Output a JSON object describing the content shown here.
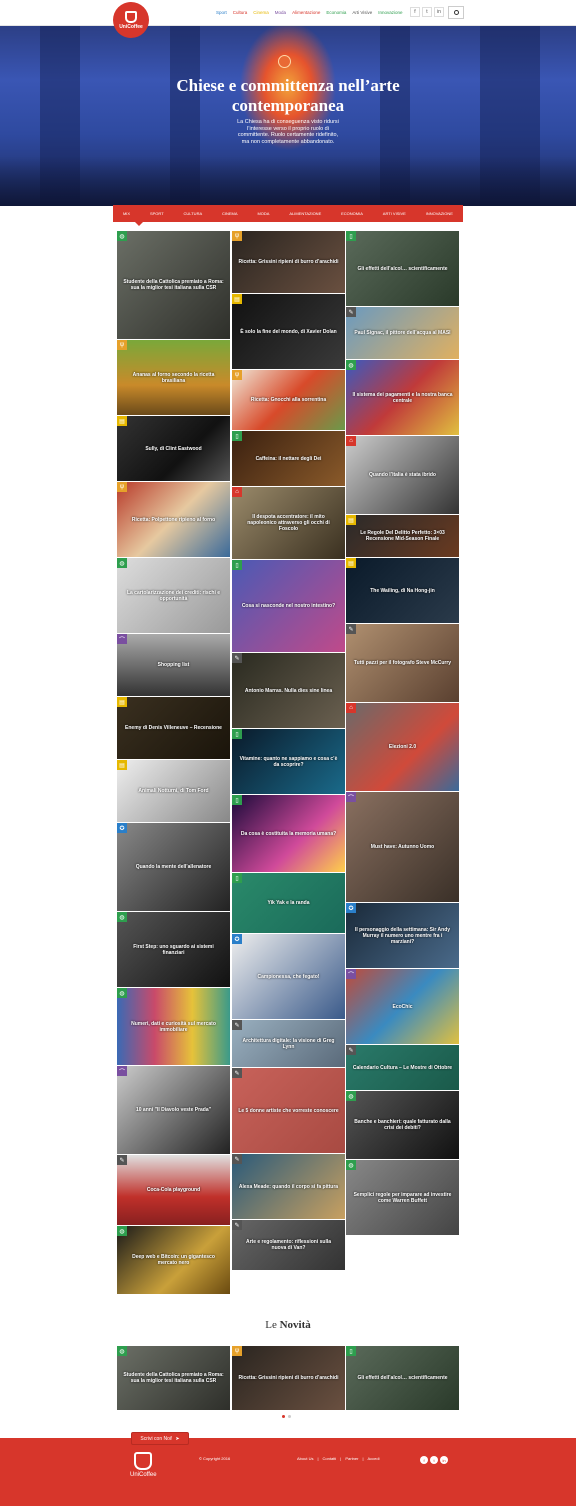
{
  "brand": {
    "name": "UniCoffee",
    "accent": "#d7362b"
  },
  "topnav": [
    {
      "label": "Sport",
      "color": "#2a7fc9"
    },
    {
      "label": "Cultura",
      "color": "#d7362b"
    },
    {
      "label": "Cinema",
      "color": "#e6b800"
    },
    {
      "label": "Moda",
      "color": "#7a4fa0"
    },
    {
      "label": "Alimentazione",
      "color": "#d7362b"
    },
    {
      "label": "Economia",
      "color": "#2e9e4e"
    },
    {
      "label": "Arti Visive",
      "color": "#555555"
    },
    {
      "label": "Innovazione",
      "color": "#2e9e4e"
    }
  ],
  "social": [
    "f",
    "t",
    "in"
  ],
  "hero": {
    "title": "Chiese e committenza nell’arte contemporanea",
    "text": "La Chiesa ha di conseguenza visto ridursi l’interesse verso il proprio ruolo di committente. Ruolo certamente ridefinito, ma non completamente abbandonato."
  },
  "catnav": [
    "MIX",
    "SPORT",
    "CULTURA",
    "CINEMA",
    "MODA",
    "ALIMENTAZIONE",
    "ECONOMIA",
    "ARTI VISIVE",
    "INNOVAZIONE"
  ],
  "tiles": {
    "c1": [
      {
        "cap": "Studente della Cattolica premiato a Roma: sua la miglior tesi italiana sulla CSR",
        "icon": "globe-icon",
        "badge": "#2e9e4e",
        "bg": "linear-gradient(135deg,#6b6f66,#2e2f2a)",
        "h": 108
      },
      {
        "cap": "Ananas al forno secondo la ricetta brasiliana",
        "icon": "fork-icon",
        "badge": "#e6a12a",
        "bg": "linear-gradient(180deg,#7aa83a,#c98a2a 60%,#6a4a1a)",
        "h": 75
      },
      {
        "cap": "Sully, di Clint Eastwood",
        "icon": "film-icon",
        "badge": "#e6b800",
        "bg": "linear-gradient(135deg,#333,#111 60%,#555)",
        "h": 65
      },
      {
        "cap": "Ricetta: Polpettone ripieno al forno",
        "icon": "fork-icon",
        "badge": "#e6a12a",
        "bg": "linear-gradient(135deg,#b83a2a,#e6c9a0 50%,#3a6a9a)",
        "h": 75
      },
      {
        "cap": "La cartolarizzazione dei crediti: rischi e opportunità",
        "icon": "globe-icon",
        "badge": "#2e9e4e",
        "bg": "linear-gradient(135deg,#ddd,#999)",
        "h": 75
      },
      {
        "cap": "Shopping list",
        "icon": "hanger-icon",
        "badge": "#7a4fa0",
        "bg": "linear-gradient(180deg,#aaa,#333)",
        "h": 62
      },
      {
        "cap": "Enemy di Denis Villeneuve – Recensione",
        "icon": "film-icon",
        "badge": "#e6b800",
        "bg": "linear-gradient(135deg,#3a3020,#1a140a)",
        "h": 62
      },
      {
        "cap": "Animali Notturni, di Tom Ford",
        "icon": "film-icon",
        "badge": "#e6b800",
        "bg": "linear-gradient(135deg,#eee,#888)",
        "h": 62
      },
      {
        "cap": "Quando la mente dell’allenatore",
        "icon": "medal-icon",
        "badge": "#2a7fc9",
        "bg": "linear-gradient(135deg,#888,#222)",
        "h": 88
      },
      {
        "cap": "First Step: uno sguardo ai sistemi finanziari",
        "icon": "globe-icon",
        "badge": "#2e9e4e",
        "bg": "linear-gradient(135deg,#555,#111)",
        "h": 75
      },
      {
        "cap": "Numeri, dati e curiosità sul mercato immobiliare",
        "icon": "globe-icon",
        "badge": "#2e9e4e",
        "bg": "linear-gradient(90deg,#3a6ab5,#c94a6a,#e6c23a,#3a9a8a)",
        "h": 77
      },
      {
        "cap": "10 anni \"Il Diavolo veste Prada\"",
        "icon": "hanger-icon",
        "badge": "#7a4fa0",
        "bg": "linear-gradient(135deg,#ccc,#222)",
        "h": 88
      },
      {
        "cap": "Coca-Cola playground",
        "icon": "brush-icon",
        "badge": "#555555",
        "bg": "linear-gradient(180deg,#e0e0e0,#c0302a 60%,#882020)",
        "h": 70
      },
      {
        "cap": "Deep web e Bitcoin: un gigantesco mercato nero",
        "icon": "globe-icon",
        "badge": "#2e9e4e",
        "bg": "linear-gradient(135deg,#1a1a1a,#c9a03a 60%,#6a4a10)",
        "h": 77
      }
    ],
    "c2": [
      {
        "cap": "Ricetta: Grissini ripieni di burro d’arachidi",
        "icon": "fork-icon",
        "badge": "#e6a12a",
        "bg": "linear-gradient(135deg,#2a2520,#6a5040)",
        "h": 62
      },
      {
        "cap": "È solo la fine del mondo, di Xavier Dolan",
        "icon": "film-icon",
        "badge": "#e6b800",
        "bg": "linear-gradient(135deg,#111,#3a3a3a)",
        "h": 75
      },
      {
        "cap": "Ricetta: Gnocchi alla sorrentina",
        "icon": "fork-icon",
        "badge": "#e6a12a",
        "bg": "linear-gradient(135deg,#f0e8d8,#d84a2a 50%,#6a9a4a)",
        "h": 60
      },
      {
        "cap": "Caffeina: il nettare degli Dei",
        "icon": "phone-icon",
        "badge": "#2e9e4e",
        "bg": "linear-gradient(135deg,#3a2010,#8a5a2a)",
        "h": 55
      },
      {
        "cap": "Il despota accentratore: il mito napoleonico attraverso gli occhi di Foscolo",
        "icon": "building-icon",
        "badge": "#d7362b",
        "bg": "linear-gradient(135deg,#9a8a6a,#3a3020)",
        "h": 72
      },
      {
        "cap": "Cosa si nasconde nel nostro intestino?",
        "icon": "phone-icon",
        "badge": "#2e9e4e",
        "bg": "linear-gradient(135deg,#4a5ab5,#c04a8a)",
        "h": 92
      },
      {
        "cap": "Antonio Marras. Nulla dies sine linea",
        "icon": "brush-icon",
        "badge": "#555555",
        "bg": "linear-gradient(135deg,#2a2a20,#6a6050)",
        "h": 75
      },
      {
        "cap": "Vitamine: quanto ne sappiamo e cosa c’è da scoprire?",
        "icon": "phone-icon",
        "badge": "#2e9e4e",
        "bg": "linear-gradient(135deg,#0a1a2a,#1a6a8a)",
        "h": 65
      },
      {
        "cap": "Da cosa è costituita la memoria umana?",
        "icon": "phone-icon",
        "badge": "#2e9e4e",
        "bg": "linear-gradient(135deg,#1a0a3a,#d04a9a 60%,#ffd04a)",
        "h": 77
      },
      {
        "cap": "Yik Yak e la randa",
        "icon": "phone-icon",
        "badge": "#2e9e4e",
        "bg": "linear-gradient(135deg,#2a8a6a,#1a6a5a)",
        "h": 60
      },
      {
        "cap": "Campionessa, che fegato!",
        "icon": "medal-icon",
        "badge": "#2a7fc9",
        "bg": "linear-gradient(135deg,#eee,#3a5a8a)",
        "h": 85
      },
      {
        "cap": "Architettura digitale: la visione di Greg Lynn",
        "icon": "brush-icon",
        "badge": "#555555",
        "bg": "linear-gradient(135deg,#9ab0c0,#5a6a7a)",
        "h": 47
      },
      {
        "cap": "Le 5 donne artiste che vorreste conoscere",
        "icon": "brush-icon",
        "badge": "#555555",
        "bg": "linear-gradient(135deg,#c8625a,#a84a42)",
        "h": 85
      },
      {
        "cap": "Alexa Meade: quando il corpo si fa pittura",
        "icon": "brush-icon",
        "badge": "#555555",
        "bg": "linear-gradient(135deg,#2a5a7a,#c8a060)",
        "h": 65
      },
      {
        "cap": "Arte e regolamento: riflessioni sulla nuova di Van?",
        "icon": "brush-icon",
        "badge": "#555555",
        "bg": "linear-gradient(135deg,#666,#333)",
        "h": 50
      }
    ],
    "c3": [
      {
        "cap": "Gli effetti dell’alcol… scientificamente",
        "icon": "phone-icon",
        "badge": "#2e9e4e",
        "bg": "linear-gradient(135deg,#5a6a5a,#2a3a2a)",
        "h": 75
      },
      {
        "cap": "Paul Signac, il pittore dell’acqua al MASI",
        "icon": "brush-icon",
        "badge": "#555555",
        "bg": "linear-gradient(135deg,#6a9ac0,#e0b060)",
        "h": 52
      },
      {
        "cap": "Il sistema dei pagamenti e la nostra banca centrale",
        "icon": "globe-icon",
        "badge": "#2e9e4e",
        "bg": "linear-gradient(135deg,#3a5ac0,#c03a3a 50%,#e0c040)",
        "h": 75
      },
      {
        "cap": "Quando l’Italia è stata ibrido",
        "icon": "building-icon",
        "badge": "#d7362b",
        "bg": "linear-gradient(135deg,#ccc,#333)",
        "h": 78
      },
      {
        "cap": "Le Regole Del Delitto Perfetto: 3×03 Recensione Mid-Season Finale",
        "icon": "film-icon",
        "badge": "#e6b800",
        "bg": "linear-gradient(135deg,#2a2a2a,#6a3a20)",
        "h": 42
      },
      {
        "cap": "The Wailing, di Na Hong-jin",
        "icon": "film-icon",
        "badge": "#e6b800",
        "bg": "linear-gradient(135deg,#0a1a2a,#2a3a4a)",
        "h": 65
      },
      {
        "cap": "Tutti pazzi per il fotografo Steve McCurry",
        "icon": "brush-icon",
        "badge": "#555555",
        "bg": "linear-gradient(135deg,#b09070,#5a4030)",
        "h": 78
      },
      {
        "cap": "Elezioni 2.0",
        "icon": "building-icon",
        "badge": "#d7362b",
        "bg": "linear-gradient(135deg,#6a6a6a,#d04a3a 60%,#3a6a9a)",
        "h": 88
      },
      {
        "cap": "Must have: Autunno Uomo",
        "icon": "hanger-icon",
        "badge": "#7a4fa0",
        "bg": "linear-gradient(135deg,#8a7060,#3a3028)",
        "h": 110
      },
      {
        "cap": "Il personaggio della settimana: Sir Andy Murray il numero uno mentre fra i marziani?",
        "icon": "medal-icon",
        "badge": "#2a7fc9",
        "bg": "linear-gradient(135deg,#1a2a3a,#4a6a8a)",
        "h": 65
      },
      {
        "cap": "EcoChic",
        "icon": "hanger-icon",
        "badge": "#7a4fa0",
        "bg": "linear-gradient(135deg,#c04a3a,#3a8ac0 50%,#e0c040)",
        "h": 75
      },
      {
        "cap": "Calendario Cultura – Le Mostre di Ottobre",
        "icon": "brush-icon",
        "badge": "#555555",
        "bg": "linear-gradient(135deg,#2a7a6a,#1a5a4a)",
        "h": 45
      },
      {
        "cap": "Banche e banchieri: quale fatturato dalla crisi dei debiti?",
        "icon": "globe-icon",
        "badge": "#2e9e4e",
        "bg": "linear-gradient(135deg,#555,#111)",
        "h": 68
      },
      {
        "cap": "Semplici regole per imparare ad investire come Warren Buffett",
        "icon": "globe-icon",
        "badge": "#2e9e4e",
        "bg": "linear-gradient(135deg,#888,#444)",
        "h": 75
      }
    ]
  },
  "novita": {
    "pre": "Le",
    "bold": "Novità"
  },
  "novita_tiles": [
    {
      "cap": "Studente della Cattolica premiato a Roma: sua la miglior tesi italiana sulla CSR",
      "icon": "globe-icon",
      "badge": "#2e9e4e",
      "bg": "linear-gradient(135deg,#6b6f66,#2e2f2a)"
    },
    {
      "cap": "Ricetta: Grissini ripieni di burro d’arachidi",
      "icon": "fork-icon",
      "badge": "#e6a12a",
      "bg": "linear-gradient(135deg,#2a2520,#6a5040)"
    },
    {
      "cap": "Gli effetti dell’alcol… scientificamente",
      "icon": "phone-icon",
      "badge": "#2e9e4e",
      "bg": "linear-gradient(135deg,#5a6a5a,#2a3a2a)"
    }
  ],
  "footer": {
    "write_label": "Scrivi con Noi!",
    "copyright": "© Copyright 2016",
    "links": [
      "About Us",
      "Contatti",
      "Partner",
      "Accedi"
    ],
    "social": [
      "f",
      "t",
      "in"
    ]
  }
}
